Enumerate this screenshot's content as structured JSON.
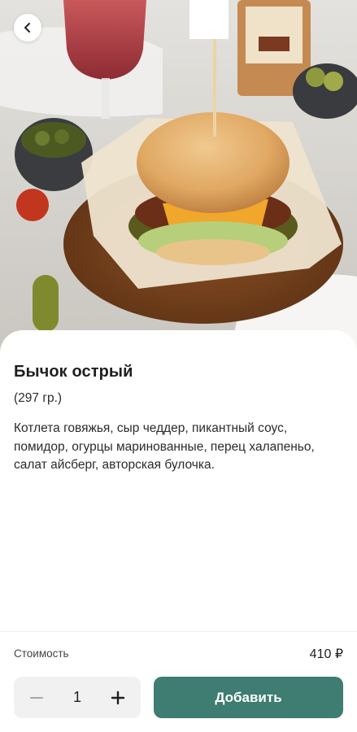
{
  "product": {
    "title": "Бычок острый",
    "weight": "(297 гр.)",
    "description": "Котлета говяжья, сыр чеддер, пикантный соус, помидор, огурцы маринованные, перец халапеньо, салат айсберг, авторская булочка."
  },
  "footer": {
    "price_label": "Стоимость",
    "price_value": "410 ₽",
    "quantity": "1",
    "add_label": "Добавить"
  },
  "colors": {
    "accent": "#3f7c71",
    "stepper_bg": "#f1f1f1"
  },
  "icons": {
    "back": "chevron-left-icon",
    "minus": "minus-icon",
    "plus": "plus-icon"
  }
}
